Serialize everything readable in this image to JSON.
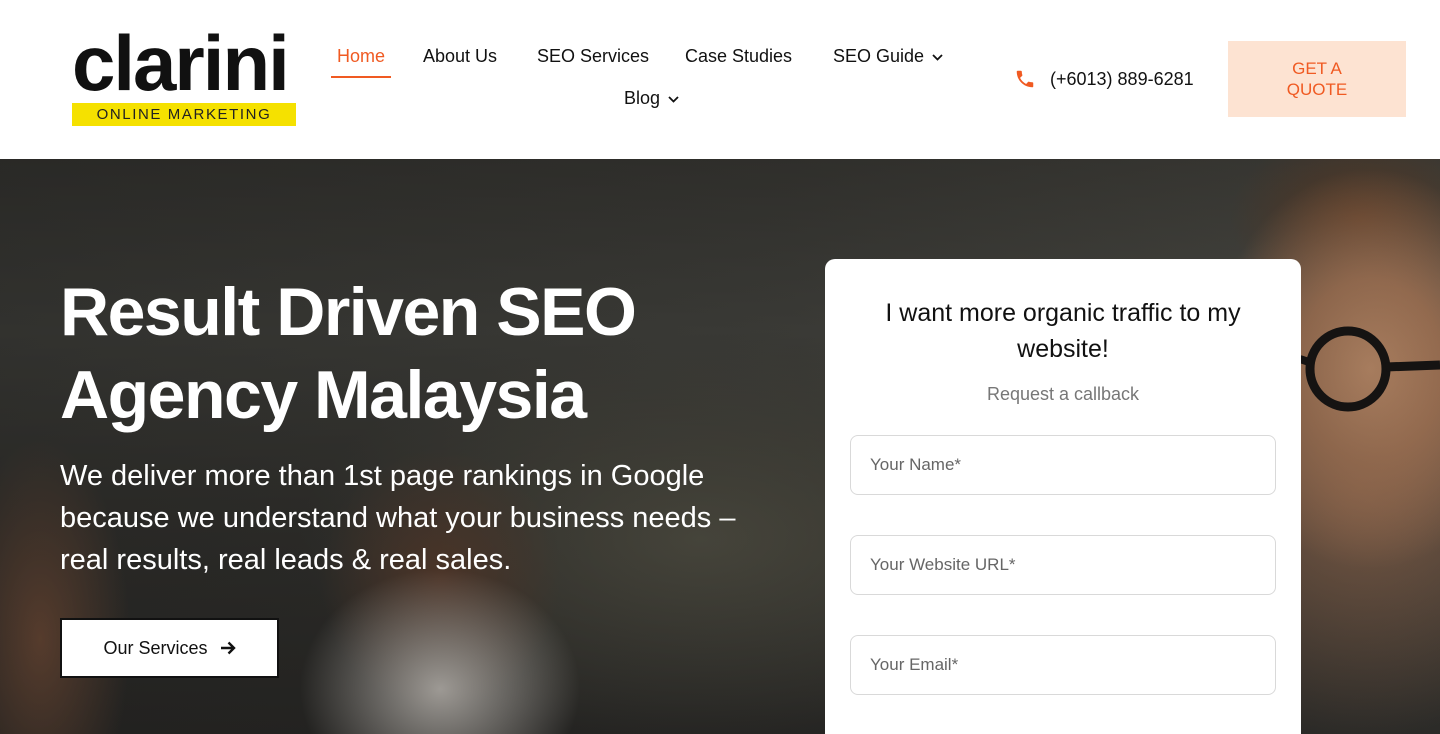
{
  "brand": {
    "name": "clarini",
    "tagline": "ONLINE MARKETING"
  },
  "nav": {
    "items": [
      {
        "label": "Home",
        "active": true
      },
      {
        "label": "About Us"
      },
      {
        "label": "SEO Services"
      },
      {
        "label": "Case Studies"
      },
      {
        "label": "SEO Guide",
        "has_dropdown": true
      },
      {
        "label": "Blog",
        "has_dropdown": true
      }
    ]
  },
  "contact": {
    "phone": "(+6013) 889-6281",
    "icon": "phone-icon"
  },
  "cta": {
    "quote_label": "GET A QUOTE"
  },
  "hero": {
    "title": "Result Driven SEO Agency Malaysia",
    "subtitle": "We deliver more than 1st page rankings in Google because we understand what your business needs – real results, real leads & real sales.",
    "button_label": "Our Services",
    "button_icon": "arrow-right-icon"
  },
  "form": {
    "title": "I want more organic traffic to my website!",
    "subtitle": "Request a callback",
    "fields": [
      {
        "placeholder": "Your Name*",
        "value": ""
      },
      {
        "placeholder": "Your Website URL*",
        "value": ""
      },
      {
        "placeholder": "Your Email*",
        "value": ""
      }
    ]
  },
  "colors": {
    "accent": "#f05a22",
    "accent_light": "#fde3d2",
    "logo_band": "#f5e100",
    "text": "#111111"
  }
}
